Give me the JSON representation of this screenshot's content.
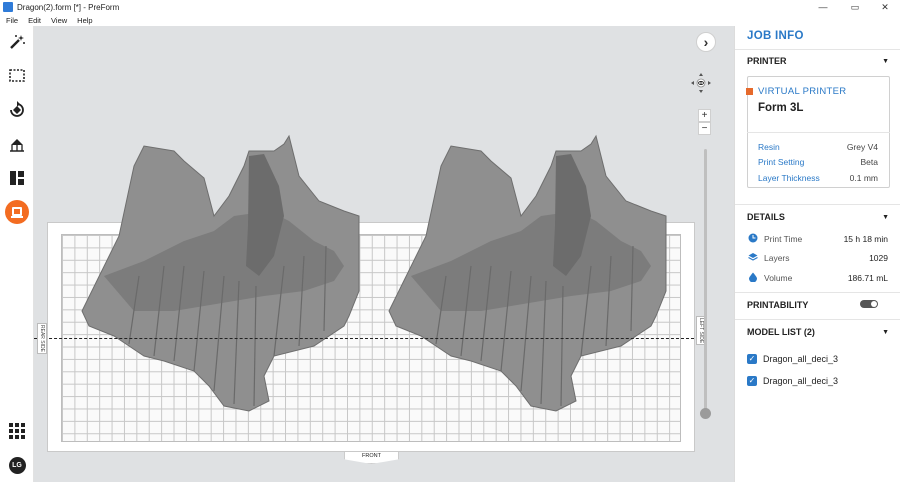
{
  "window": {
    "title": "Dragon(2).form [*] - PreForm",
    "controls": {
      "minimize": "—",
      "maximize": "▭",
      "close": "✕"
    }
  },
  "menu": [
    "File",
    "Edit",
    "View",
    "Help"
  ],
  "toolbar": {
    "tools": [
      "magic-wand",
      "select",
      "orientation",
      "supports",
      "layout",
      "print"
    ],
    "active_tool": "print",
    "bottom": {
      "apps": "apps",
      "avatar": "LG"
    }
  },
  "viewport": {
    "labels": {
      "back": "REAR SIDE",
      "right": "LEFT SIDE",
      "front": "FRONT"
    },
    "zoom": {
      "in": "+",
      "out": "−"
    },
    "collapse_panel": "›"
  },
  "panel": {
    "title": "JOB INFO",
    "printer": {
      "header": "PRINTER",
      "type": "VIRTUAL PRINTER",
      "model": "Form 3L",
      "rows": [
        {
          "label": "Resin",
          "value": "Grey V4"
        },
        {
          "label": "Print Setting",
          "value": "Beta"
        },
        {
          "label": "Layer Thickness",
          "value": "0.1 mm"
        }
      ]
    },
    "details": {
      "header": "DETAILS",
      "rows": [
        {
          "label": "Print Time",
          "value": "15 h 18 min",
          "icon": "clock-icon"
        },
        {
          "label": "Layers",
          "value": "1029",
          "icon": "layers-icon"
        },
        {
          "label": "Volume",
          "value": "186.71 mL",
          "icon": "droplet-icon"
        }
      ]
    },
    "printability": {
      "header": "PRINTABILITY"
    },
    "model_list": {
      "header": "MODEL LIST (2)",
      "items": [
        "Dragon_all_deci_3",
        "Dragon_all_deci_3"
      ]
    }
  },
  "colors": {
    "accent": "#2a79c7",
    "brand": "#f36c21",
    "viewport_bg": "#dfe1e3"
  }
}
